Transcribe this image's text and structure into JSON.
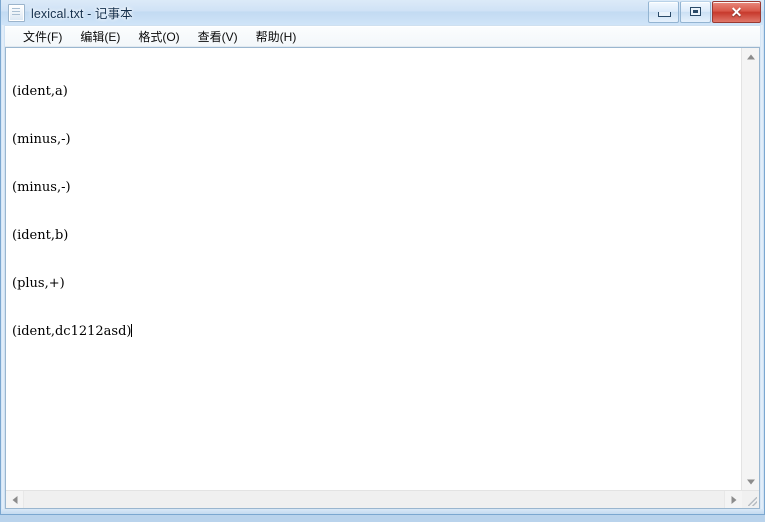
{
  "window": {
    "title": "lexical.txt - 记事本",
    "icon": "notepad-icon",
    "controls": {
      "minimize_label": "—",
      "maximize_label": "▢",
      "close_label": "✕"
    }
  },
  "menubar": {
    "items": [
      {
        "label": "文件(F)",
        "name": "file"
      },
      {
        "label": "编辑(E)",
        "name": "edit"
      },
      {
        "label": "格式(O)",
        "name": "format"
      },
      {
        "label": "查看(V)",
        "name": "view"
      },
      {
        "label": "帮助(H)",
        "name": "help"
      }
    ]
  },
  "editor": {
    "lines": [
      "(ident,a)",
      "(minus,-)",
      "(minus,-)",
      "(ident,b)",
      "(plus,+)",
      "(ident,dc1212asd)"
    ]
  },
  "scrollbars": {
    "vertical": {
      "up_arrow": "▲",
      "down_arrow": "▼"
    },
    "horizontal": {
      "left_arrow": "◀",
      "right_arrow": "▶"
    }
  },
  "colors": {
    "titlebar": "#cfe2f6",
    "close_button": "#c7392c",
    "client_background": "#ffffff",
    "text": "#000000"
  }
}
